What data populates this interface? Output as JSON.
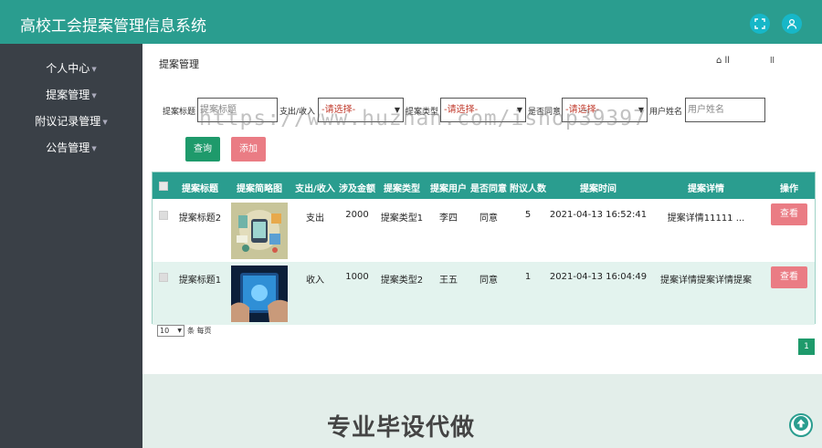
{
  "app": {
    "title": "高校工会提案管理信息系统"
  },
  "sidebar": {
    "items": [
      {
        "label": "个人中心"
      },
      {
        "label": "提案管理"
      },
      {
        "label": "附议记录管理"
      },
      {
        "label": "公告管理"
      }
    ]
  },
  "breadcrumb": {
    "current": "提案管理",
    "right1": "⌂ ll",
    "right2": "ll"
  },
  "filters": {
    "title_label": "提案标题",
    "title_placeholder": "提案标题",
    "type_label": "支出/收入",
    "type_select": "-请选择-",
    "category_label": "提案类型",
    "category_select": "-请选择-",
    "agree_label": "是否同意",
    "agree_select": "-请选择-",
    "user_label": "用户姓名",
    "user_placeholder": "用户姓名"
  },
  "actions": {
    "query": "查询",
    "add": "添加"
  },
  "table": {
    "headers": [
      "提案标题",
      "提案简略图",
      "支出/收入",
      "涉及金额",
      "提案类型",
      "提案用户",
      "是否同意",
      "附议人数",
      "提案时间",
      "提案详情",
      "操作"
    ],
    "rows": [
      {
        "title": "提案标题2",
        "io": "支出",
        "amount": "2000",
        "category": "提案类型1",
        "user": "李四",
        "agree": "同意",
        "count": "5",
        "time": "2021-04-13 16:52:41",
        "detail": "提案详情11111 ...",
        "action": "查看"
      },
      {
        "title": "提案标题1",
        "io": "收入",
        "amount": "1000",
        "category": "提案类型2",
        "user": "王五",
        "agree": "同意",
        "count": "1",
        "time": "2021-04-13 16:04:49",
        "detail": "提案详情提案详情提案",
        "action": "查看"
      }
    ]
  },
  "pager": {
    "page_size": "10",
    "per_page_label": "条 每页",
    "current_page": "1"
  },
  "footer": {
    "text": "专业毕设代做"
  },
  "watermark": "https://www.huzhan.com/ishop39397",
  "colors": {
    "primary": "#2a9d8f",
    "sidebar": "#3a4047",
    "danger": "#ea7c84",
    "success": "#1e9a6b"
  }
}
